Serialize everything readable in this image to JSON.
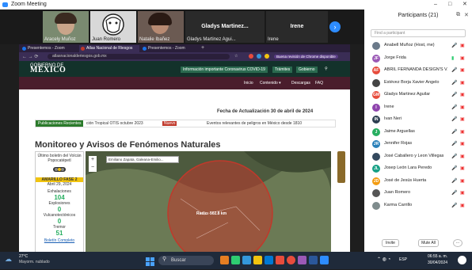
{
  "titlebar": {
    "title": "Zoom Meeting",
    "minimize": "–",
    "restore": "□",
    "close": "✕"
  },
  "gallery": [
    {
      "name": "Aracely Muñoz"
    },
    {
      "name": "Juan Romero"
    },
    {
      "name": "Natalie Ibañez"
    },
    {
      "name": "Gladys Martinez Agui...",
      "center": "Gladys Martinez..."
    },
    {
      "name": "Irene",
      "center": "Irene"
    }
  ],
  "browser": {
    "tabs": [
      "Presentemos - Zoom",
      "Atlas Nacional de Riesgos",
      "Presentemos - Zoom"
    ],
    "url": "atlasnacionalderiesgos.gob.mx",
    "warning": "Buena revisión de Chrome disponible",
    "gov_label": "GOBIERNO DE",
    "gov_name": "MÉXICO",
    "nav_top": [
      "Información importante Coronavirus COVID-19",
      "Trámites",
      "Gobierno"
    ],
    "nav_second": [
      "Inicio",
      "Contenido ▾",
      "Descargas",
      "FAQ"
    ],
    "update_date": "Fecha de Actualización 30 de abril de 2024",
    "ticker_label": "Publicaciones Recientes",
    "ticker_items": [
      "ción Tropical OTIS octubre 2023",
      "Nuevo",
      "Eventos relevantes de peligros en México desde 1810"
    ],
    "heading": "Monitoreo y Avisos de Fenómenos Naturales",
    "volcano": {
      "title": "Último boletín del Volcán Popocatépetl",
      "phase": "AMARILLO FASE 2",
      "date": "Abril 29, 2024",
      "exhalaciones_label": "Exhalaciones",
      "exhalaciones": "104",
      "explosiones_label": "Explosiones",
      "explosiones": "0",
      "vt_label": "Vulcanotectónicos",
      "vt": "0",
      "tremor_label": "Tremor",
      "tremor": "51",
      "link": "Boletín Completo"
    },
    "map": {
      "search": "Emiliano Zapata, Galeana-Emilio...",
      "radius_label": "Radio: 502.8 km"
    }
  },
  "participants": {
    "title": "Participants (21)",
    "search_placeholder": "Find a participant",
    "list": [
      {
        "name": "Anabell Muñoz (Host, me)",
        "initials": "",
        "color": "#6b7a8a"
      },
      {
        "name": "Jorge Frida",
        "initials": "JF",
        "color": "#9b59b6"
      },
      {
        "name": "ABRIL FERNANDA DESIGN'S V...",
        "initials": "AF",
        "color": "#e74c3c"
      },
      {
        "name": "Estévez Borja Xavier Angelo",
        "initials": "",
        "color": "#444"
      },
      {
        "name": "Gladys Martinez Aguilar",
        "initials": "GM",
        "color": "#e74c3c"
      },
      {
        "name": "Irene",
        "initials": "I",
        "color": "#8e44ad"
      },
      {
        "name": "Ivan Neri",
        "initials": "IN",
        "color": "#2c3e50"
      },
      {
        "name": "Jaime Arguellas",
        "initials": "J",
        "color": "#27ae60"
      },
      {
        "name": "Jennifer Rojas",
        "initials": "JR",
        "color": "#2980b9"
      },
      {
        "name": "José Caballero y Leon Villegas",
        "initials": "",
        "color": "#34495e"
      },
      {
        "name": "Josep León Lara Peredo",
        "initials": "JL",
        "color": "#16a085"
      },
      {
        "name": "José de Jesús Huerta",
        "initials": "JD",
        "color": "#f39c12"
      },
      {
        "name": "Juan Romero",
        "initials": "",
        "color": "#555"
      },
      {
        "name": "Karma Carrillo",
        "initials": "",
        "color": "#7f8c8d"
      }
    ],
    "invite": "Invite",
    "mute_all": "Mute All",
    "more": "···"
  },
  "taskbar": {
    "temp": "27°C",
    "weather": "Mayorm. nublado",
    "search": "Buscar",
    "time": "06:55 a. m.",
    "date": "30/04/2024",
    "lang": "ESP"
  }
}
